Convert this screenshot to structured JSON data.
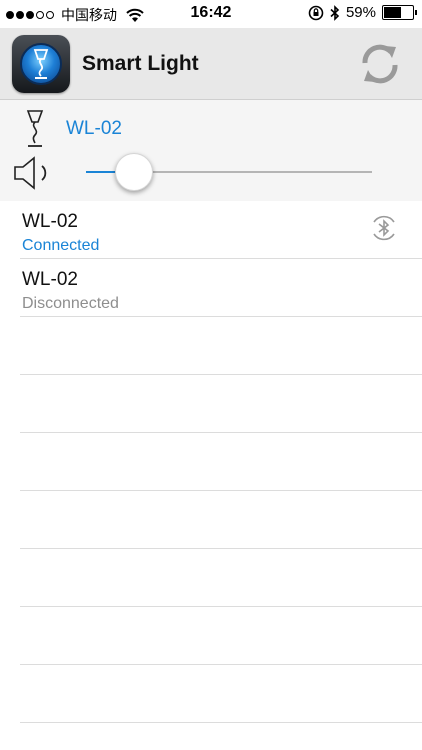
{
  "status_bar": {
    "signal_dots_filled": 3,
    "signal_dots_total": 5,
    "carrier": "中国移动",
    "time": "16:42",
    "battery_text": "59%",
    "battery_level": 0.59
  },
  "header": {
    "title": "Smart Light",
    "app_icon": "lamp-app-icon",
    "action_icon": "refresh-icon"
  },
  "control": {
    "device_name": "WL-02",
    "volume_level": 0.14,
    "accent_color": "#1a84d6"
  },
  "devices": [
    {
      "name": "WL-02",
      "status": "Connected",
      "icon": "bluetooth-icon"
    },
    {
      "name": "WL-02",
      "status": "Disconnected"
    }
  ],
  "empty_rows": 7
}
